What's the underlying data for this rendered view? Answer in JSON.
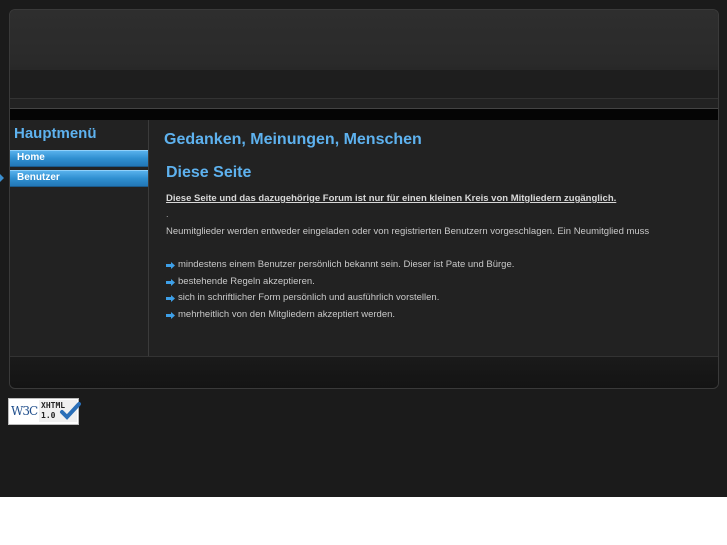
{
  "sidebar": {
    "title": "Hauptmenü",
    "items": [
      {
        "label": "Home"
      },
      {
        "label": "Benutzer"
      }
    ]
  },
  "content": {
    "site_title": "Gedanken, Meinungen, Menschen",
    "section_title": "Diese Seite",
    "intro": "Diese Seite und das dazugehörige Forum ist nur für einen kleinen Kreis von Mitgliedern zugänglich.",
    "dot": ".",
    "paragraph": "Neumitglieder werden entweder eingeladen oder von registrierten Benutzern vorgeschlagen. Ein Neumitglied muss",
    "bullets": [
      "mindestens einem Benutzer persönlich bekannt sein. Dieser ist Pate und Bürge.",
      "bestehende Regeln akzeptieren.",
      "sich in schriftlicher Form persönlich und ausführlich vorstellen.",
      "mehrheitlich von den Mitgliedern akzeptiert werden."
    ]
  },
  "badge": {
    "w3c": "W3C",
    "xhtml": "XHTML",
    "version": "1.0"
  },
  "colors": {
    "accent": "#5eb2ef",
    "menu": "#2f8fd0",
    "background": "#1b1b1b"
  }
}
